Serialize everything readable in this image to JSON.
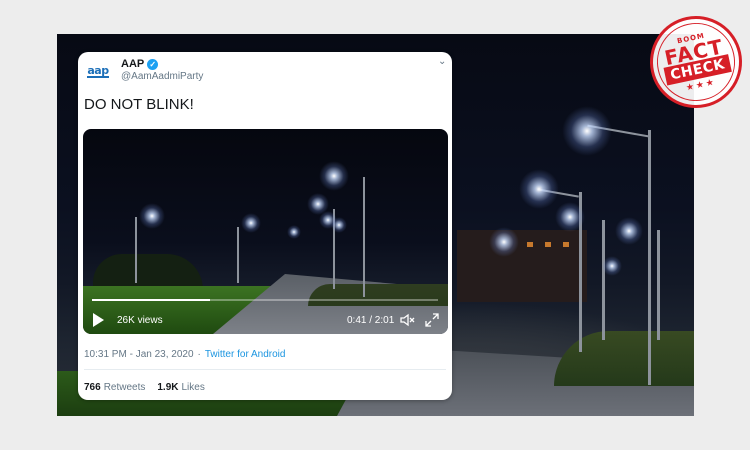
{
  "tweet": {
    "display_name": "AAP",
    "handle": "@AamAadmiParty",
    "avatar_text": "aap",
    "text": "DO NOT BLINK!",
    "timestamp": "10:31 PM - Jan 23, 2020",
    "separator": "·",
    "source": "Twitter for Android",
    "retweets_count": "766",
    "retweets_label": "Retweets",
    "likes_count": "1.9K",
    "likes_label": "Likes"
  },
  "video": {
    "views": "26K views",
    "time": "0:41 / 2:01",
    "progress": 0.34
  },
  "stamp": {
    "top": "BOOM",
    "line1": "FACT",
    "line2": "CHECK",
    "stars": "★★★"
  },
  "colors": {
    "stamp_red": "#d61f27",
    "twitter_blue": "#1da1f2",
    "link_blue": "#1b95e0"
  }
}
